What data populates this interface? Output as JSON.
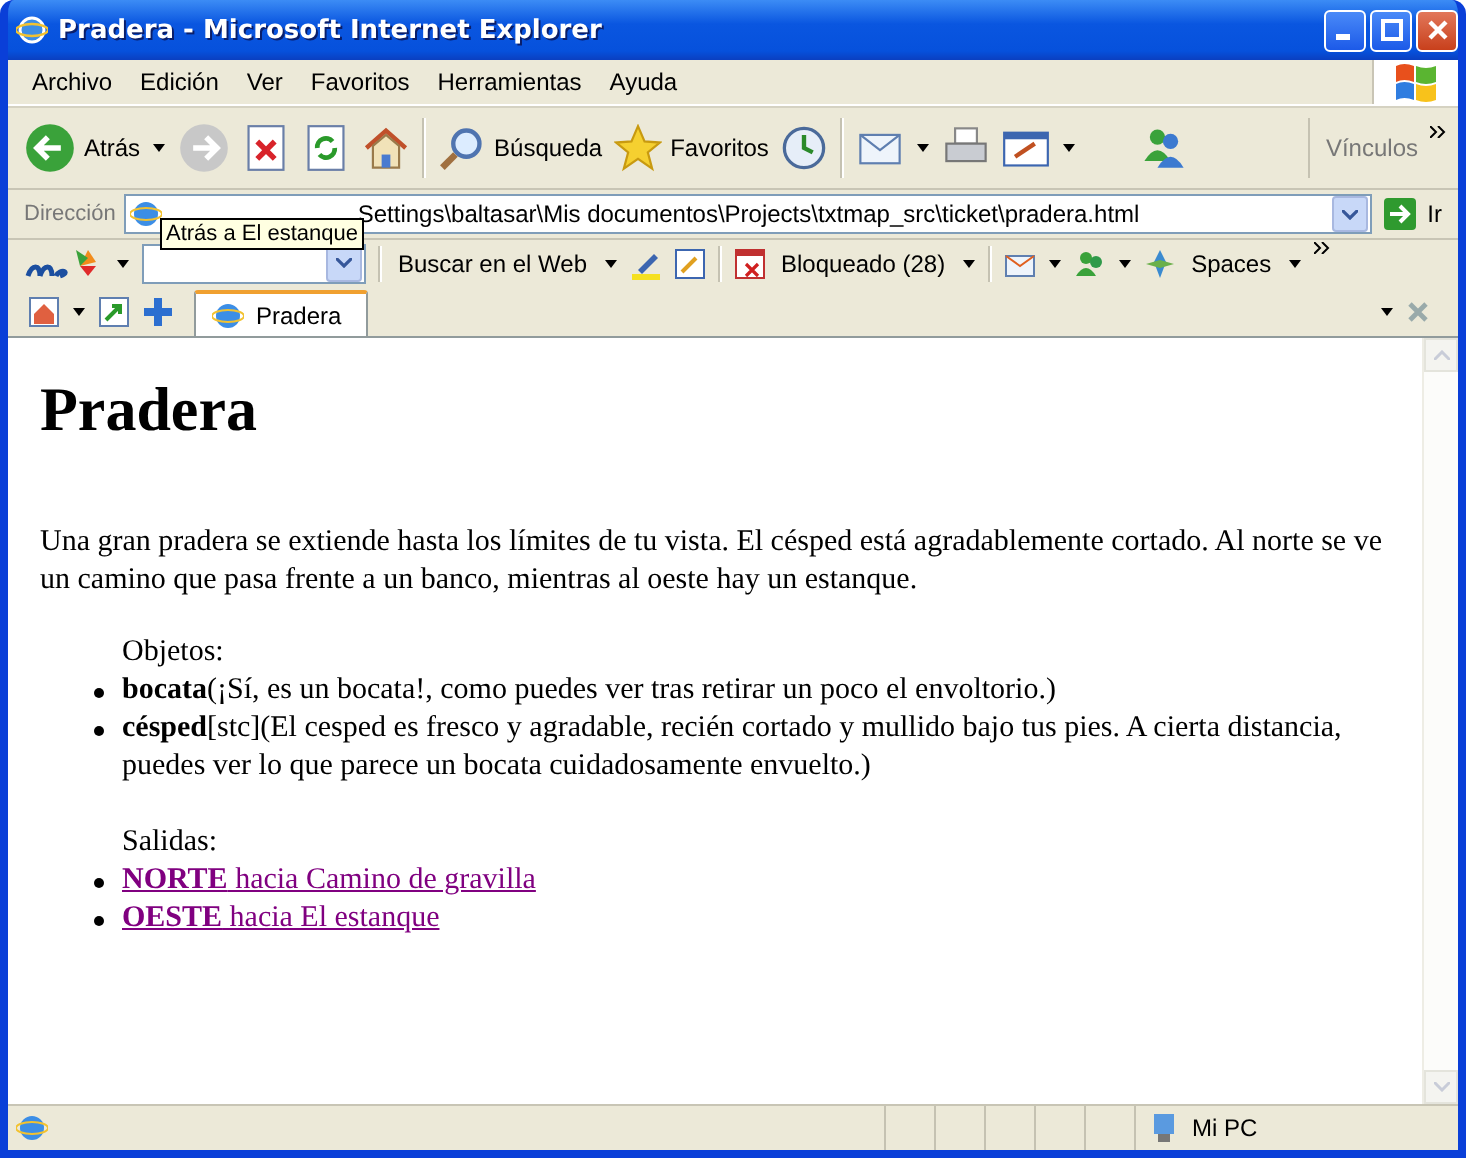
{
  "window": {
    "title": "Pradera - Microsoft Internet Explorer"
  },
  "menu": [
    "Archivo",
    "Edición",
    "Ver",
    "Favoritos",
    "Herramientas",
    "Ayuda"
  ],
  "toolbar": {
    "back": "Atrás",
    "search": "Búsqueda",
    "favorites": "Favoritos",
    "links": "Vínculos"
  },
  "address": {
    "label": "Dirección",
    "value": "Settings\\baltasar\\Mis documentos\\Projects\\txtmap_src\\ticket\\pradera.html",
    "go": "Ir"
  },
  "tooltip": "Atrás a El estanque",
  "msn_bar": {
    "search": "Buscar en el Web",
    "blocked": "Bloqueado (28)",
    "spaces": "Spaces"
  },
  "tabs": [
    {
      "label": "Pradera",
      "selected": true
    }
  ],
  "page": {
    "heading": "Pradera",
    "description": "Una gran pradera se extiende hasta los límites de tu vista. El césped está agradablemente cortado. Al norte se ve un camino que pasa frente a un banco, mientras al oeste hay un estanque.",
    "objects_label": "Objetos:",
    "objects": [
      "**bocata**(¡Sí, es un bocata!, como puedes ver tras retirar un poco el envoltorio.)",
      "**césped**[stc](El cesped es fresco y agradable, recién cortado y mullido bajo tus pies. A cierta distancia, puedes ver lo que parece un bocata cuidadosamente envuelto.)"
    ],
    "exits_label": "Salidas:",
    "exits": [
      "**NORTE** hacia Camino de gravilla",
      "**OESTE** hacia El estanque"
    ]
  },
  "status_bar": {
    "zone": "Mi PC"
  }
}
